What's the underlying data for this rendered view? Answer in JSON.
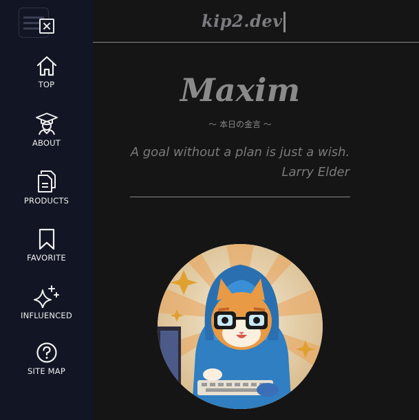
{
  "header": {
    "site_title": "kip2.dev"
  },
  "profile": {
    "name": "Maxim",
    "quote_title": "～ 本日の金言 ～",
    "quote_text": "A goal without a plan is just a wish.",
    "quote_author": "Larry Elder"
  },
  "sidebar": {
    "items": [
      {
        "label": "TOP",
        "icon": "home-icon"
      },
      {
        "label": "ABOUT",
        "icon": "graduate-icon"
      },
      {
        "label": "PRODUCTS",
        "icon": "documents-icon"
      },
      {
        "label": "FAVORITE",
        "icon": "bookmark-icon"
      },
      {
        "label": "INFLUENCED",
        "icon": "sparkles-icon"
      },
      {
        "label": "SITE MAP",
        "icon": "help-circle-icon"
      }
    ]
  },
  "colors": {
    "sidebar_bg": "#121624",
    "page_bg": "#151515",
    "text_dim": "#8a8a8a"
  }
}
